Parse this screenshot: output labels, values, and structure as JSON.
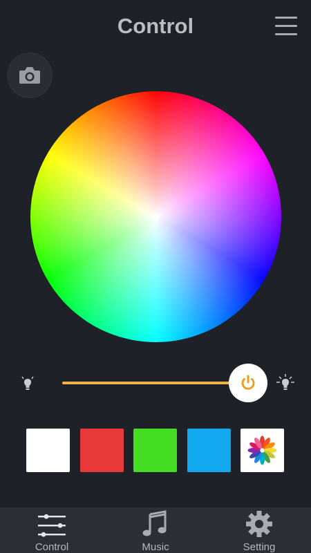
{
  "header": {
    "title": "Control",
    "menu_icon": "hamburger-menu-icon"
  },
  "camera_button": {
    "icon": "camera-icon"
  },
  "color_wheel": {
    "selected_color": "#ffffff"
  },
  "brightness": {
    "level_fraction": 0.9,
    "min_icon": "dim-bulb-icon",
    "max_icon": "bright-bulb-icon",
    "power_icon": "power-icon",
    "accent_color": "#f0b347",
    "power_icon_color": "#e9a020"
  },
  "presets": [
    {
      "name": "white",
      "color": "#ffffff"
    },
    {
      "name": "red",
      "color": "#e83a3a"
    },
    {
      "name": "green",
      "color": "#44dd22"
    },
    {
      "name": "blue",
      "color": "#12a8f0"
    },
    {
      "name": "custom",
      "icon": "color-flower-icon"
    }
  ],
  "bottom_nav": [
    {
      "label": "Control",
      "icon": "sliders-icon",
      "active": true
    },
    {
      "label": "Music",
      "icon": "music-note-icon",
      "active": false
    },
    {
      "label": "Setting",
      "icon": "gear-icon",
      "active": false
    }
  ]
}
